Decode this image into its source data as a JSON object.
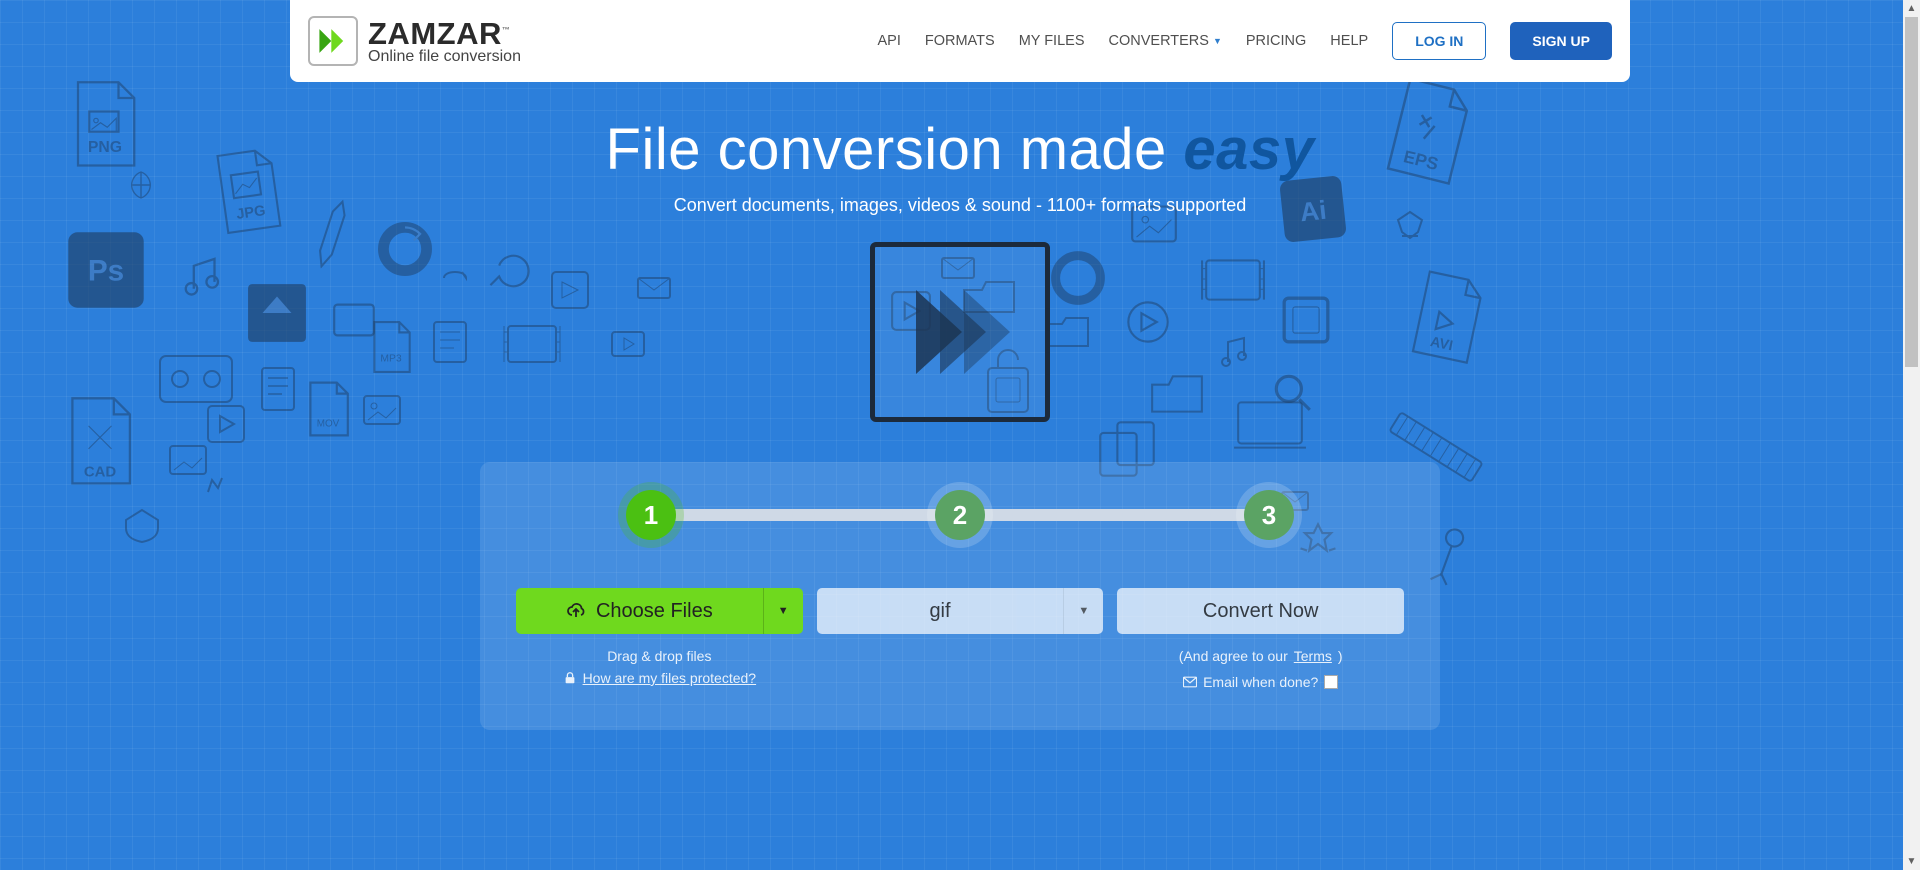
{
  "brand": {
    "name": "ZAMZAR",
    "tagline": "Online file conversion",
    "tm": "™"
  },
  "nav": {
    "api": "API",
    "formats": "FORMATS",
    "myfiles": "MY FILES",
    "converters": "CONVERTERS",
    "pricing": "PRICING",
    "help": "HELP",
    "login": "LOG IN",
    "signup": "SIGN UP"
  },
  "hero": {
    "title_lead": "File conversion made ",
    "title_emph": "easy",
    "subtitle": "Convert documents, images, videos & sound - 1100+ formats supported"
  },
  "steps": [
    "1",
    "2",
    "3"
  ],
  "controls": {
    "choose": "Choose Files",
    "dragdrop": "Drag & drop files",
    "protected": "How are my files protected?",
    "format": "gif",
    "convert": "Convert Now",
    "terms_lead": "(And agree to our ",
    "terms_link": "Terms",
    "terms_tail": ")",
    "email_label": "Email when done?"
  }
}
